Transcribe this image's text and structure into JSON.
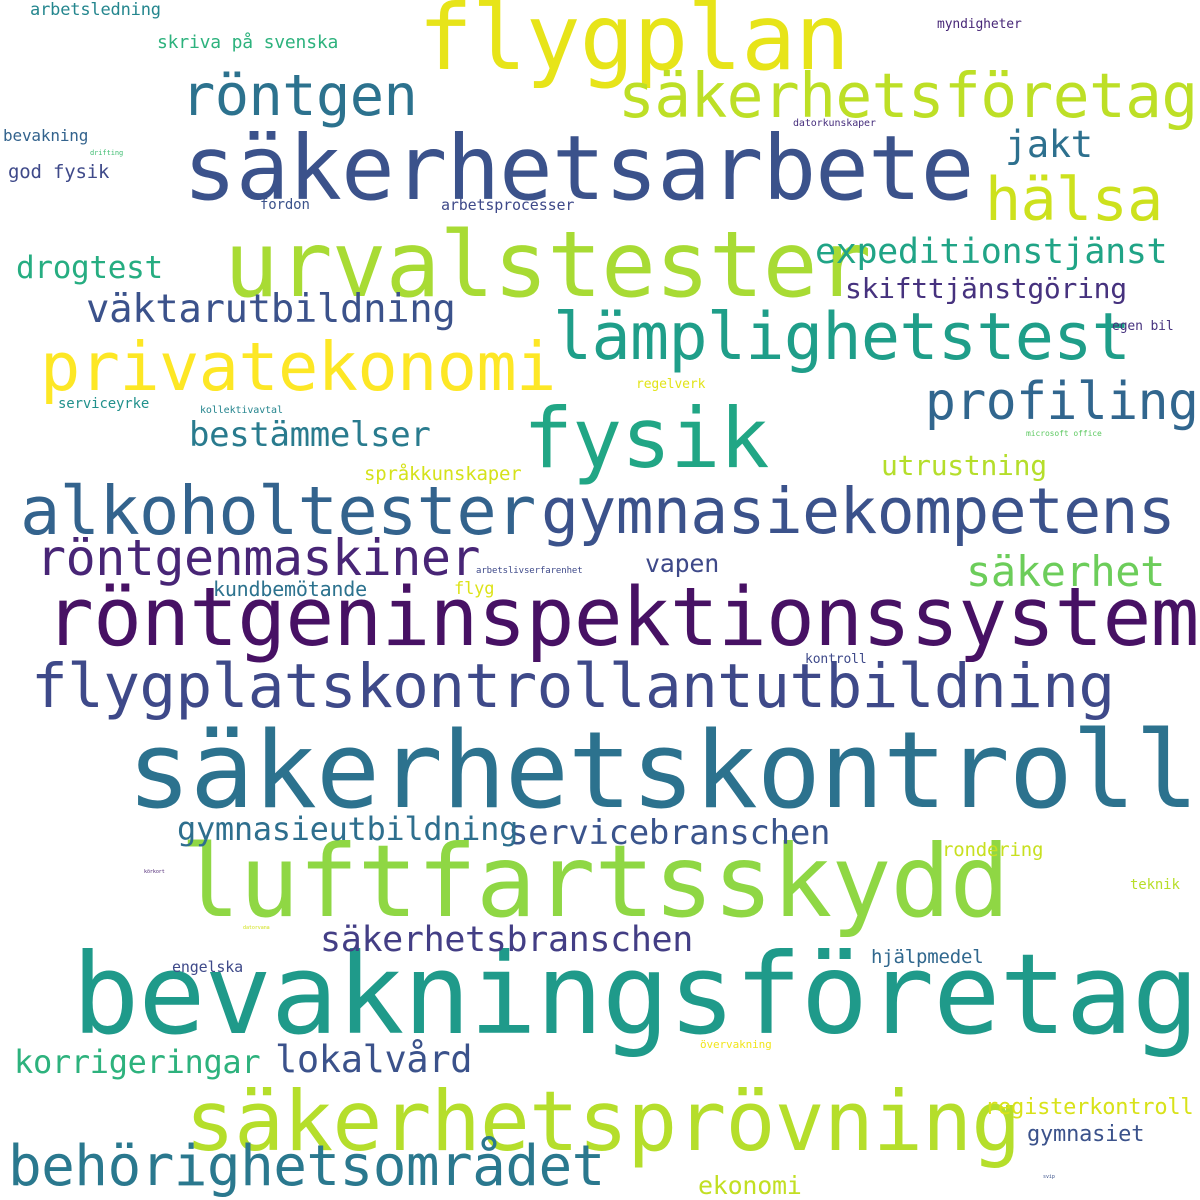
{
  "word_cloud": {
    "words": [
      {
        "text": "röntgeninspektionssystem",
        "color": "#471164"
      },
      {
        "text": "bevakningsföretag",
        "color": "#1f9a8a"
      },
      {
        "text": "säkerhetskontroll",
        "color": "#2c728e"
      },
      {
        "text": "luftfartsskydd",
        "color": "#8fd744"
      },
      {
        "text": "säkerhetsarbete",
        "color": "#3b528b"
      },
      {
        "text": "flygplan",
        "color": "#e7e419"
      },
      {
        "text": "urvalstester",
        "color": "#a8db34"
      },
      {
        "text": "säkerhetsprövning",
        "color": "#b5de2b"
      },
      {
        "text": "flygplatskontrollantutbildning",
        "color": "#3e4989"
      },
      {
        "text": "gymnasiekompetens",
        "color": "#3b528b"
      },
      {
        "text": "alkoholtester",
        "color": "#33638d"
      },
      {
        "text": "fysik",
        "color": "#21a685"
      },
      {
        "text": "privatekonomi",
        "color": "#fde725"
      },
      {
        "text": "säkerhetsföretag",
        "color": "#bddf26"
      },
      {
        "text": "lämplighetstest",
        "color": "#1f9e89"
      },
      {
        "text": "behörighetsområdet",
        "color": "#2a788e"
      },
      {
        "text": "röntgenmaskiner",
        "color": "#482576"
      },
      {
        "text": "röntgen",
        "color": "#2c728e"
      },
      {
        "text": "hälsa",
        "color": "#cde11d"
      },
      {
        "text": "profiling",
        "color": "#31668e"
      },
      {
        "text": "säkerhet",
        "color": "#6ccd5a"
      },
      {
        "text": "väktarutbildning",
        "color": "#3b528b"
      },
      {
        "text": "expeditionstjänst",
        "color": "#20a486"
      },
      {
        "text": "säkerhetsbranschen",
        "color": "#433e85"
      },
      {
        "text": "servicebranschen",
        "color": "#3a548c"
      },
      {
        "text": "gymnasieutbildning",
        "color": "#2e6f8e"
      },
      {
        "text": "bestämmelser",
        "color": "#297b8e"
      },
      {
        "text": "lokalvård",
        "color": "#3b528b"
      },
      {
        "text": "korrigeringar",
        "color": "#2db27d"
      },
      {
        "text": "drogtest",
        "color": "#26ad81"
      },
      {
        "text": "jakt",
        "color": "#2d708e"
      },
      {
        "text": "skifttjänstgöring",
        "color": "#46327e"
      },
      {
        "text": "utrustning",
        "color": "#b5de2b"
      },
      {
        "text": "vapen",
        "color": "#3e4989"
      },
      {
        "text": "ekonomi",
        "color": "#c2df23"
      },
      {
        "text": "gymnasiet",
        "color": "#3b528b"
      },
      {
        "text": "registerkontroll",
        "color": "#d8e219"
      },
      {
        "text": "kundbemötande",
        "color": "#2c728e"
      },
      {
        "text": "hjälpmedel",
        "color": "#31688e"
      },
      {
        "text": "skriva på svenska",
        "color": "#2db27d"
      },
      {
        "text": "rondering",
        "color": "#c8e020"
      },
      {
        "text": "arbetsledning",
        "color": "#24868e"
      },
      {
        "text": "språkkunskaper",
        "color": "#d5e21a"
      },
      {
        "text": "god fysik",
        "color": "#3e4989"
      },
      {
        "text": "bevakning",
        "color": "#33638d"
      },
      {
        "text": "engelska",
        "color": "#3e4989"
      },
      {
        "text": "flyg",
        "color": "#dde318"
      },
      {
        "text": "arbetsprocesser",
        "color": "#3e4989"
      },
      {
        "text": "fordon",
        "color": "#3b528b"
      },
      {
        "text": "kontroll",
        "color": "#3e4989"
      },
      {
        "text": "teknik",
        "color": "#b8de29"
      },
      {
        "text": "regelverk",
        "color": "#e2e418"
      },
      {
        "text": "serviceyrke",
        "color": "#21918c"
      },
      {
        "text": "myndigheter",
        "color": "#482878"
      },
      {
        "text": "egen bil",
        "color": "#46327e"
      },
      {
        "text": "övervakning",
        "color": "#f1e51d"
      },
      {
        "text": "kollektivavtal",
        "color": "#25858e"
      },
      {
        "text": "datorkunskaper",
        "color": "#472f7d"
      },
      {
        "text": "arbetslivserfarenhet",
        "color": "#3e4989"
      },
      {
        "text": "microsoft office",
        "color": "#5ec962"
      },
      {
        "text": "drifting",
        "color": "#40bd72"
      },
      {
        "text": "körkort",
        "color": "#481f70"
      },
      {
        "text": "datorvana",
        "color": "#d2e21b"
      },
      {
        "text": "svip",
        "color": "#3b528b"
      }
    ]
  }
}
